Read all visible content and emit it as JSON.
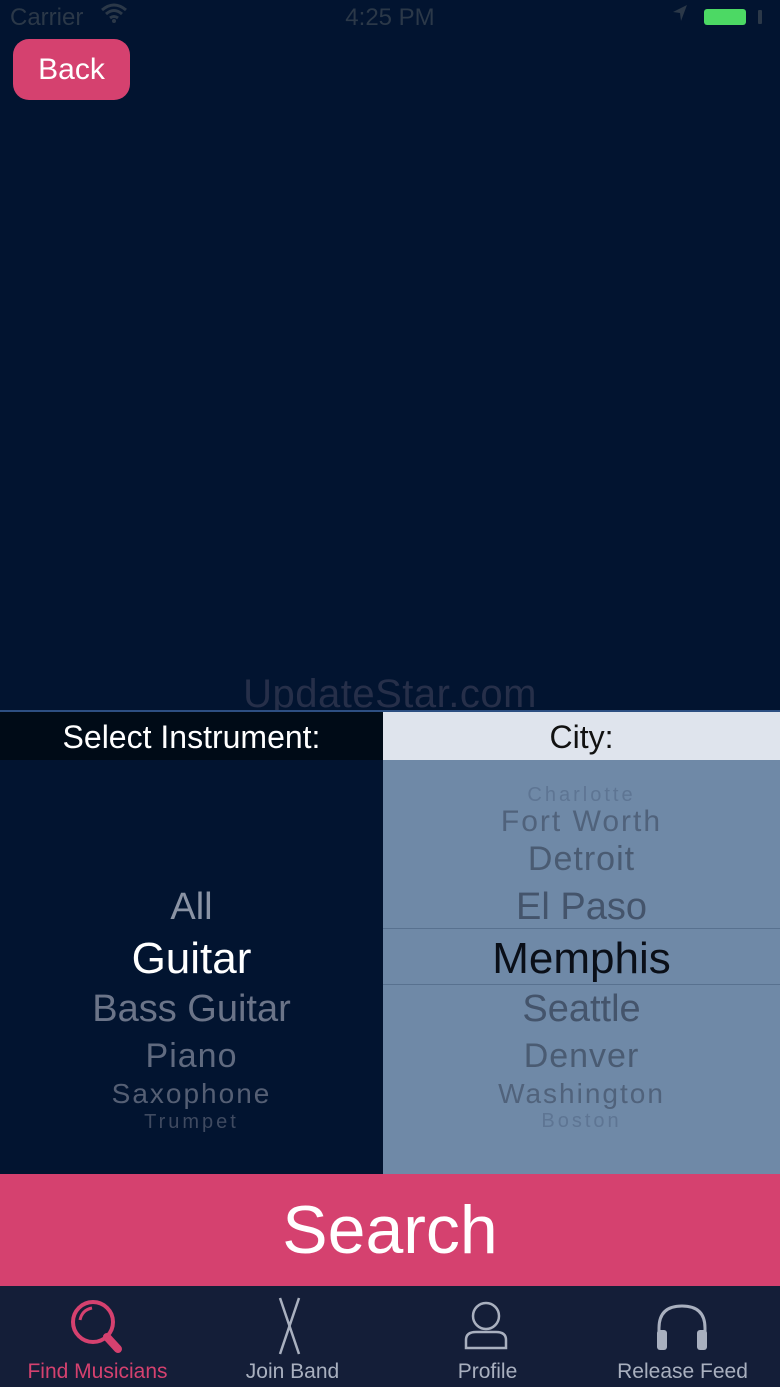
{
  "status_bar": {
    "carrier": "Carrier",
    "time": "4:25 PM"
  },
  "back_button": {
    "label": "Back"
  },
  "watermark": "UpdateStar.com",
  "instrument": {
    "header": "Select Instrument:",
    "options": [
      "All",
      "Guitar",
      "Bass Guitar",
      "Piano",
      "Saxophone",
      "Trumpet"
    ],
    "selected": "Guitar"
  },
  "city": {
    "header": "City:",
    "options": [
      "Charlotte",
      "Fort Worth",
      "Detroit",
      "El Paso",
      "Memphis",
      "Seattle",
      "Denver",
      "Washington",
      "Boston"
    ],
    "selected": "Memphis"
  },
  "search_button": {
    "label": "Search"
  },
  "tab_bar": {
    "tabs": [
      {
        "label": "Find Musicians",
        "icon": "search-icon",
        "active": true
      },
      {
        "label": "Join Band",
        "icon": "drumsticks-icon",
        "active": false
      },
      {
        "label": "Profile",
        "icon": "person-icon",
        "active": false
      },
      {
        "label": "Release Feed",
        "icon": "headphones-icon",
        "active": false
      }
    ]
  },
  "colors": {
    "accent": "#d5416f",
    "background": "#021430",
    "city_picker": "#6f89a7"
  }
}
